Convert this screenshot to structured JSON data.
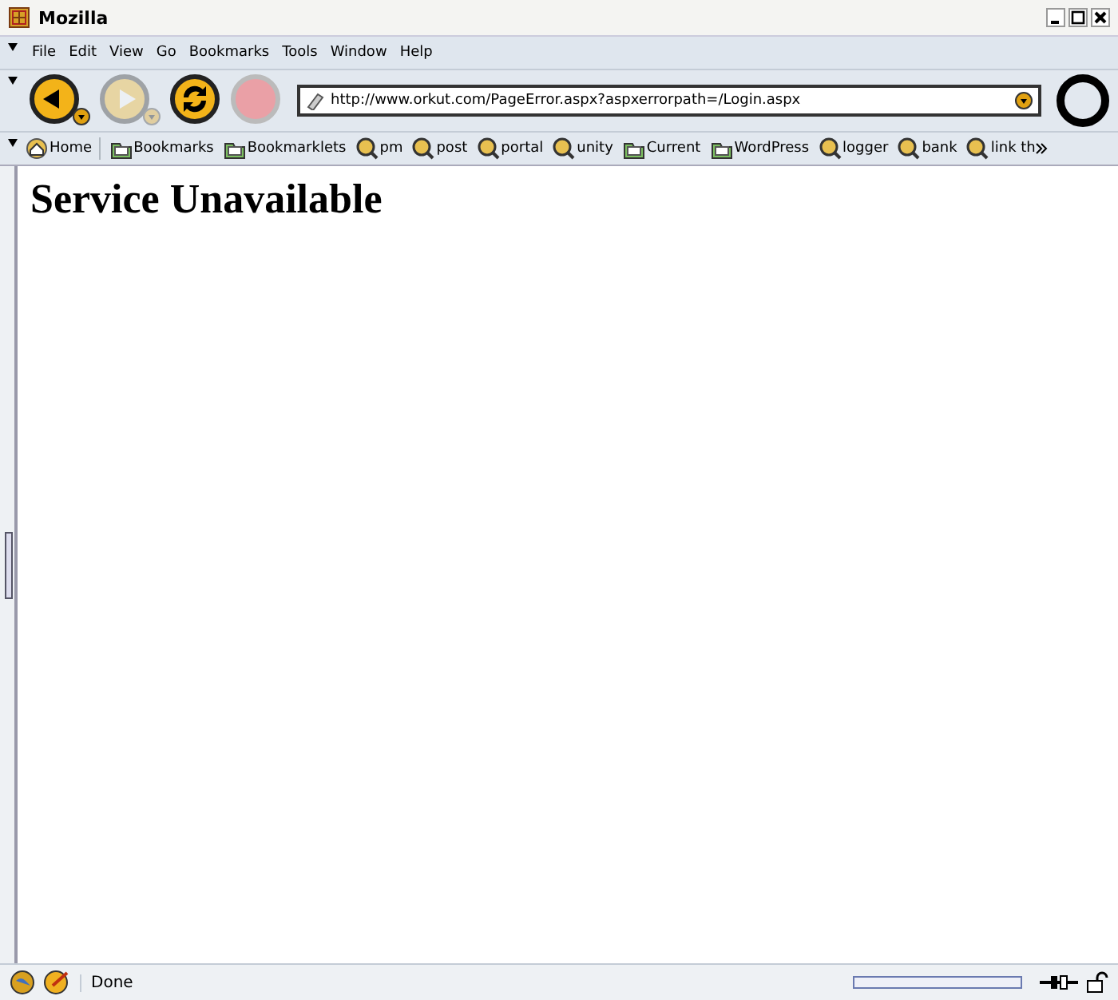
{
  "window": {
    "title": "Mozilla"
  },
  "menu": [
    "File",
    "Edit",
    "View",
    "Go",
    "Bookmarks",
    "Tools",
    "Window",
    "Help"
  ],
  "navigation": {
    "back_disabled": false,
    "forward_disabled": true,
    "stop_disabled": true,
    "url": "http://www.orkut.com/PageError.aspx?aspxerrorpath=/Login.aspx"
  },
  "bookmarks": [
    {
      "kind": "home",
      "label": "Home"
    },
    {
      "kind": "folder",
      "label": "Bookmarks"
    },
    {
      "kind": "folder",
      "label": "Bookmarklets"
    },
    {
      "kind": "link",
      "label": "pm"
    },
    {
      "kind": "link",
      "label": "post"
    },
    {
      "kind": "link",
      "label": "portal"
    },
    {
      "kind": "link",
      "label": "unity"
    },
    {
      "kind": "folder",
      "label": "Current"
    },
    {
      "kind": "folder",
      "label": "WordPress"
    },
    {
      "kind": "link",
      "label": "logger"
    },
    {
      "kind": "link",
      "label": "bank"
    },
    {
      "kind": "link",
      "label": "link th"
    }
  ],
  "page": {
    "heading": "Service Unavailable"
  },
  "status_bar": {
    "text": "Done",
    "level": 0
  }
}
